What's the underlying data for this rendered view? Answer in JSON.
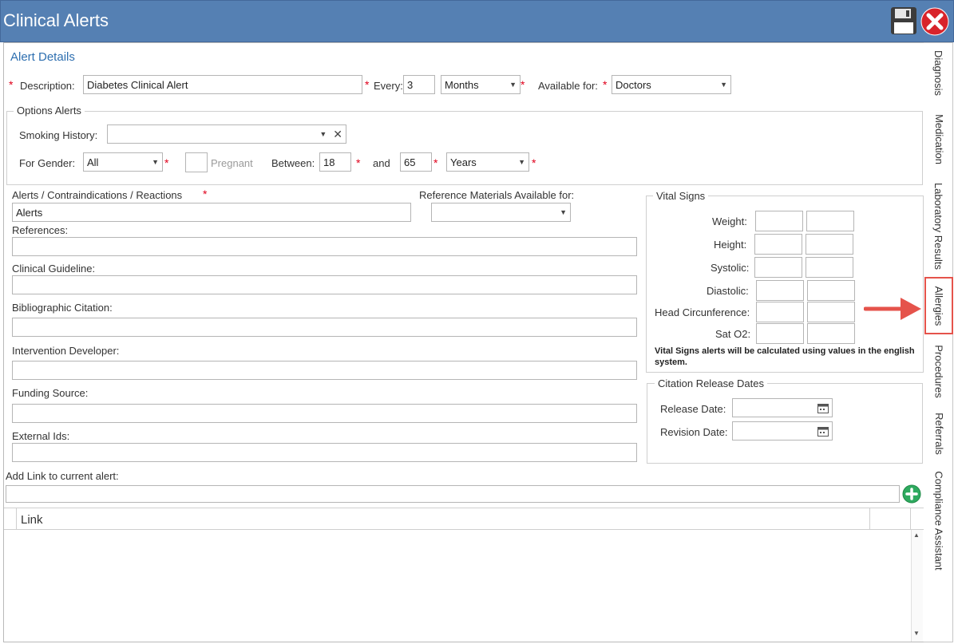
{
  "window": {
    "title": "Clinical Alerts"
  },
  "section": {
    "title": "Alert Details"
  },
  "alert": {
    "description_label": "Description:",
    "description_value": "Diabetes Clinical Alert",
    "every_label": "Every:",
    "every_value": "3",
    "period_value": "Months",
    "available_label": "Available for:",
    "available_value": "Doctors"
  },
  "options": {
    "legend": "Options Alerts",
    "smoking_label": "Smoking History:",
    "smoking_value": "",
    "gender_label": "For Gender:",
    "gender_value": "All",
    "pregnant_label": "Pregnant",
    "between_label": "Between:",
    "between_from": "18",
    "and_label": "and",
    "between_to": "65",
    "age_unit": "Years"
  },
  "fields": {
    "alerts_label": "Alerts / Contraindications / Reactions",
    "alerts_value": "Alerts",
    "ref_materials_label": "Reference Materials Available for:",
    "ref_materials_value": "",
    "references_label": "References:",
    "guideline_label": "Clinical Guideline:",
    "citation_label": "Bibliographic Citation:",
    "developer_label": "Intervention Developer:",
    "funding_label": "Funding Source:",
    "external_label": "External Ids:",
    "link_label": "Add Link to current alert:",
    "link_value": ""
  },
  "vitals": {
    "legend": "Vital Signs",
    "rows": [
      "Weight:",
      "Height:",
      "Systolic:",
      "Diastolic:",
      "Head Circunference:",
      "Sat O2:"
    ],
    "note": "Vital Signs alerts will be calculated using values in the english system."
  },
  "citation_dates": {
    "legend": "Citation Release Dates",
    "release_label": "Release Date:",
    "revision_label": "Revision Date:"
  },
  "grid": {
    "column_link": "Link"
  },
  "tabs": [
    "Diagnosis",
    "Medication",
    "Laboratory Results",
    "Allergies",
    "Procedures",
    "Referrals",
    "Compliance Assistant"
  ],
  "colors": {
    "titlebar": "#5580b3",
    "accent_title": "#2e6fb0",
    "required": "#e0001b",
    "highlight": "#e5534b",
    "add_button": "#2eaa5f"
  },
  "icons": {
    "save": "floppy-disk",
    "close": "red-circle-x",
    "add": "green-plus",
    "calendar": "calendar"
  }
}
